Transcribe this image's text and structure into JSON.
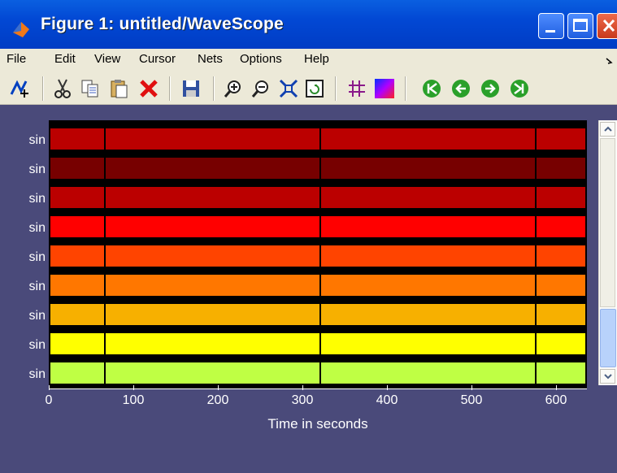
{
  "window": {
    "title": "Figure 1: untitled/WaveScope"
  },
  "menu": [
    "File",
    "Edit",
    "View",
    "Cursor",
    "Nets",
    "Options",
    "Help"
  ],
  "toolbar_icons": [
    "pointer-add-icon",
    "cut-icon",
    "copy-icon",
    "paste-icon",
    "delete-icon",
    "save-icon",
    "zoom-in-icon",
    "zoom-out-icon",
    "fit-icon",
    "refresh-icon",
    "grid-icon",
    "colormap-icon",
    "first-icon",
    "prev-icon",
    "next-icon",
    "last-icon"
  ],
  "signals": [
    {
      "label": "sin",
      "color": "#bb0000"
    },
    {
      "label": "sin",
      "color": "#770000"
    },
    {
      "label": "sin",
      "color": "#bb0000"
    },
    {
      "label": "sin",
      "color": "#ff0000"
    },
    {
      "label": "sin",
      "color": "#ff4400"
    },
    {
      "label": "sin",
      "color": "#ff7700"
    },
    {
      "label": "sin",
      "color": "#f7b000"
    },
    {
      "label": "sin",
      "color": "#ffff00"
    },
    {
      "label": "sin",
      "color": "#bfff44"
    }
  ],
  "cursors": [
    65,
    320,
    575
  ],
  "x_ticks": [
    "0",
    "100",
    "200",
    "300",
    "400",
    "500",
    "600"
  ],
  "x_label": "Time in seconds"
}
